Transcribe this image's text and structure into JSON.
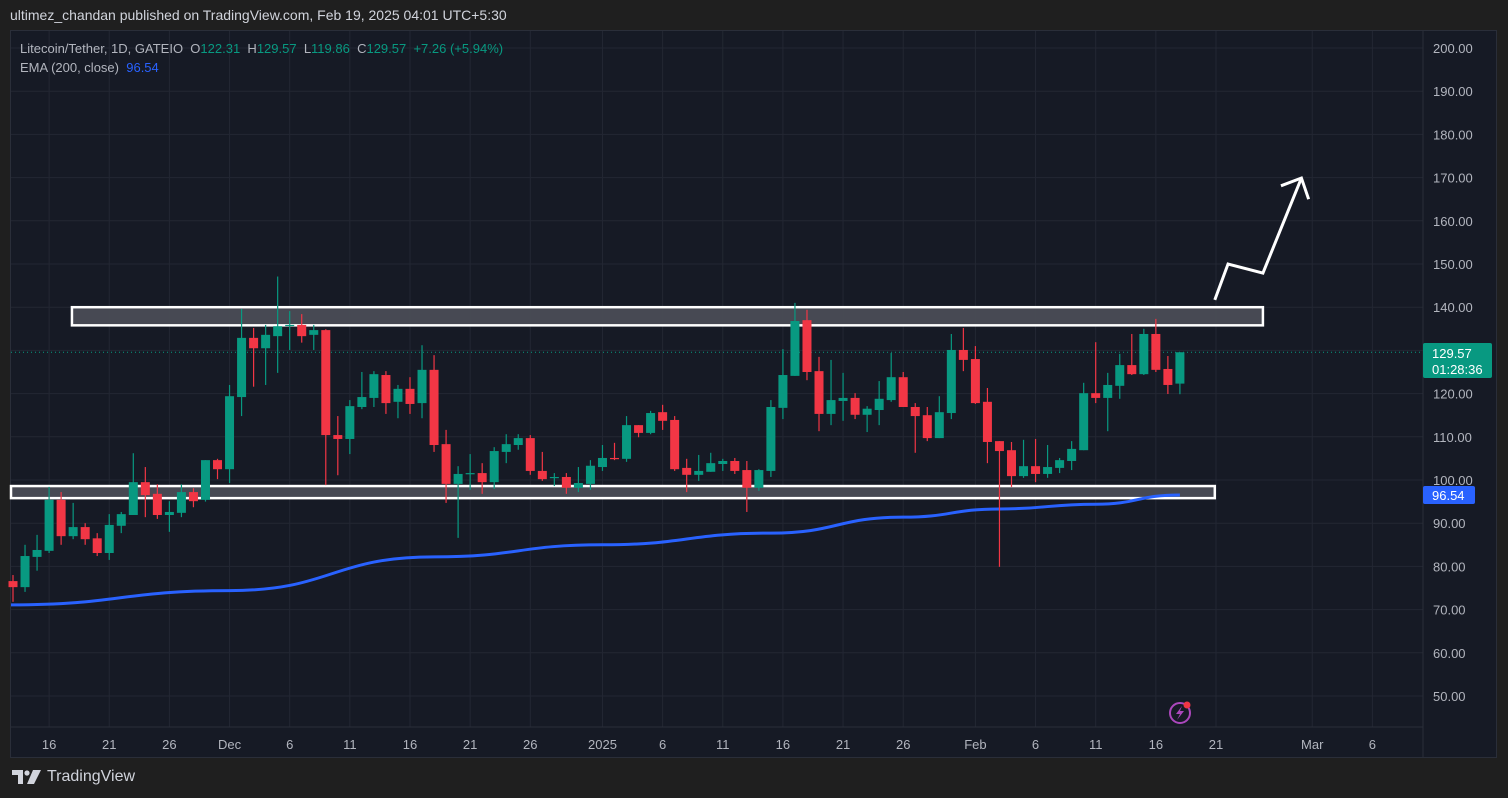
{
  "header": {
    "published": "ultimez_chandan published on TradingView.com, Feb 19, 2025 04:01 UTC+5:30"
  },
  "legend": {
    "symbol": "Litecoin/Tether, 1D, GATEIO",
    "o_label": "O",
    "o": "122.31",
    "h_label": "H",
    "h": "129.57",
    "l_label": "L",
    "l": "119.86",
    "c_label": "C",
    "c": "129.57",
    "change": "+7.26 (+5.94%)",
    "ema_label": "EMA (200, close)",
    "ema_value": "96.54"
  },
  "price_tag": {
    "price": "129.57",
    "countdown": "01:28:36"
  },
  "ema_tag": {
    "value": "96.54"
  },
  "footer": {
    "brand": "TradingView"
  },
  "colors": {
    "up": "#089981",
    "down": "#f23645",
    "ema": "#2962ff",
    "zone_fill": "#4a4c55",
    "zone_border": "#ffffff"
  },
  "chart_data": {
    "type": "candlestick",
    "title": "Litecoin/Tether, 1D, GATEIO",
    "ylim": [
      45,
      205
    ],
    "y_ticks": [
      "200.00",
      "190.00",
      "180.00",
      "170.00",
      "160.00",
      "150.00",
      "140.00",
      "130.00",
      "120.00",
      "110.00",
      "100.00",
      "90.00",
      "80.00",
      "70.00",
      "60.00",
      "50.00"
    ],
    "y_tick_values": [
      200,
      190,
      180,
      170,
      160,
      150,
      140,
      130,
      120,
      110,
      100,
      90,
      80,
      70,
      60,
      50
    ],
    "x_ticks": [
      {
        "label": "16",
        "day": 3
      },
      {
        "label": "21",
        "day": 8
      },
      {
        "label": "26",
        "day": 13
      },
      {
        "label": "Dec",
        "day": 18
      },
      {
        "label": "6",
        "day": 23
      },
      {
        "label": "11",
        "day": 28
      },
      {
        "label": "16",
        "day": 33
      },
      {
        "label": "21",
        "day": 38
      },
      {
        "label": "26",
        "day": 43
      },
      {
        "label": "2025",
        "day": 49
      },
      {
        "label": "6",
        "day": 54
      },
      {
        "label": "11",
        "day": 59
      },
      {
        "label": "16",
        "day": 64
      },
      {
        "label": "21",
        "day": 69
      },
      {
        "label": "26",
        "day": 74
      },
      {
        "label": "Feb",
        "day": 80
      },
      {
        "label": "6",
        "day": 85
      },
      {
        "label": "11",
        "day": 90
      },
      {
        "label": "16",
        "day": 95
      },
      {
        "label": "21",
        "day": 100
      },
      {
        "label": "Mar",
        "day": 108
      },
      {
        "label": "6",
        "day": 113
      }
    ],
    "ohlc": [
      [
        76.6,
        78.0,
        71.8,
        75.2
      ],
      [
        75.2,
        85.0,
        74.1,
        82.4
      ],
      [
        82.2,
        87.3,
        79.0,
        83.8
      ],
      [
        83.6,
        98.4,
        83.1,
        95.4
      ],
      [
        95.4,
        97.2,
        85.0,
        87.0
      ],
      [
        87.0,
        94.7,
        86.3,
        89.1
      ],
      [
        89.1,
        90.0,
        85.0,
        86.3
      ],
      [
        86.5,
        87.7,
        82.4,
        83.1
      ],
      [
        83.1,
        92.1,
        81.5,
        89.6
      ],
      [
        89.4,
        92.6,
        87.7,
        92.1
      ],
      [
        91.9,
        106.2,
        91.9,
        99.5
      ],
      [
        99.5,
        103.0,
        91.4,
        96.5
      ],
      [
        96.8,
        99.0,
        91.0,
        91.9
      ],
      [
        91.9,
        95.1,
        88.0,
        92.6
      ],
      [
        92.4,
        99.0,
        91.4,
        97.2
      ],
      [
        97.2,
        98.1,
        93.7,
        95.1
      ],
      [
        95.4,
        104.6,
        95.0,
        104.6
      ],
      [
        104.6,
        104.9,
        100.2,
        102.5
      ],
      [
        102.5,
        122.0,
        99.3,
        119.4
      ],
      [
        119.2,
        139.6,
        114.8,
        132.9
      ],
      [
        132.9,
        135.2,
        121.6,
        130.5
      ],
      [
        130.5,
        135.9,
        122.0,
        133.6
      ],
      [
        133.3,
        147.1,
        124.8,
        135.6
      ],
      [
        135.7,
        139.1,
        130.1,
        135.9
      ],
      [
        135.9,
        138.4,
        131.8,
        133.3
      ],
      [
        133.6,
        135.9,
        130.1,
        134.7
      ],
      [
        134.7,
        134.9,
        98.8,
        110.4
      ],
      [
        110.4,
        114.8,
        101.1,
        109.5
      ],
      [
        109.5,
        118.5,
        106.0,
        117.1
      ],
      [
        116.9,
        125.0,
        116.4,
        119.2
      ],
      [
        119.0,
        125.2,
        116.9,
        124.5
      ],
      [
        124.3,
        125.2,
        115.3,
        117.8
      ],
      [
        118.1,
        122.0,
        114.3,
        121.1
      ],
      [
        121.1,
        123.8,
        115.3,
        117.6
      ],
      [
        117.8,
        131.2,
        114.3,
        125.5
      ],
      [
        125.5,
        128.9,
        106.5,
        108.1
      ],
      [
        108.3,
        111.6,
        94.7,
        99.1
      ],
      [
        99.1,
        103.2,
        86.6,
        101.4
      ],
      [
        101.4,
        106.0,
        97.7,
        101.6
      ],
      [
        101.6,
        103.9,
        96.8,
        99.5
      ],
      [
        99.5,
        107.6,
        97.9,
        106.7
      ],
      [
        106.5,
        110.6,
        103.9,
        108.3
      ],
      [
        108.1,
        110.6,
        107.0,
        109.7
      ],
      [
        109.7,
        110.4,
        101.2,
        102.1
      ],
      [
        102.1,
        106.5,
        99.8,
        100.2
      ],
      [
        100.5,
        101.6,
        98.6,
        100.7
      ],
      [
        100.7,
        101.6,
        96.8,
        98.2
      ],
      [
        98.2,
        103.0,
        97.2,
        99.3
      ],
      [
        99.1,
        104.6,
        97.7,
        103.3
      ],
      [
        103.0,
        108.1,
        102.1,
        105.1
      ],
      [
        105.1,
        108.6,
        104.6,
        104.9
      ],
      [
        104.9,
        114.8,
        104.2,
        112.7
      ],
      [
        112.7,
        112.7,
        109.9,
        110.9
      ],
      [
        110.9,
        116.0,
        110.6,
        115.5
      ],
      [
        115.7,
        117.4,
        111.6,
        113.7
      ],
      [
        113.9,
        114.8,
        102.1,
        102.5
      ],
      [
        102.8,
        104.9,
        97.2,
        101.2
      ],
      [
        101.2,
        105.8,
        99.8,
        102.1
      ],
      [
        101.9,
        106.3,
        101.9,
        103.9
      ],
      [
        103.7,
        104.9,
        102.1,
        104.4
      ],
      [
        104.4,
        105.1,
        101.4,
        102.1
      ],
      [
        102.3,
        104.4,
        92.6,
        98.2
      ],
      [
        98.2,
        102.5,
        97.5,
        102.3
      ],
      [
        102.1,
        118.5,
        100.7,
        116.9
      ],
      [
        116.7,
        130.3,
        114.1,
        124.3
      ],
      [
        124.1,
        141.0,
        124.1,
        136.8
      ],
      [
        137.0,
        139.4,
        123.1,
        125.0
      ],
      [
        125.2,
        128.5,
        111.3,
        115.3
      ],
      [
        115.3,
        127.8,
        112.7,
        118.5
      ],
      [
        118.3,
        124.8,
        113.7,
        119.0
      ],
      [
        119.0,
        120.1,
        114.1,
        115.1
      ],
      [
        115.1,
        117.1,
        111.1,
        116.5
      ],
      [
        116.2,
        122.9,
        112.7,
        118.8
      ],
      [
        118.5,
        129.4,
        118.1,
        123.8
      ],
      [
        123.8,
        125.0,
        116.9,
        116.9
      ],
      [
        116.9,
        117.8,
        106.3,
        114.8
      ],
      [
        115.0,
        116.9,
        109.0,
        109.7
      ],
      [
        109.7,
        119.4,
        109.7,
        115.7
      ],
      [
        115.5,
        133.8,
        114.1,
        130.1
      ],
      [
        130.1,
        135.2,
        125.2,
        127.8
      ],
      [
        128.0,
        131.0,
        117.6,
        117.8
      ],
      [
        118.1,
        121.3,
        103.9,
        108.8
      ],
      [
        109.0,
        109.0,
        79.9,
        106.7
      ],
      [
        106.9,
        108.8,
        98.4,
        100.9
      ],
      [
        100.9,
        109.3,
        100.5,
        103.2
      ],
      [
        103.2,
        109.5,
        99.5,
        101.4
      ],
      [
        101.4,
        108.1,
        100.5,
        103.0
      ],
      [
        102.8,
        105.1,
        101.6,
        104.6
      ],
      [
        104.4,
        109.0,
        102.3,
        107.2
      ],
      [
        106.9,
        122.5,
        106.9,
        120.1
      ],
      [
        120.1,
        131.9,
        117.8,
        119.0
      ],
      [
        119.0,
        124.8,
        111.3,
        122.0
      ],
      [
        121.8,
        129.2,
        118.8,
        126.6
      ],
      [
        126.6,
        133.8,
        124.3,
        124.5
      ],
      [
        124.5,
        135.0,
        124.3,
        133.8
      ],
      [
        133.8,
        137.3,
        125.0,
        125.5
      ],
      [
        125.7,
        128.7,
        119.9,
        122.0
      ],
      [
        122.31,
        129.57,
        119.86,
        129.57
      ]
    ],
    "ema200": [
      [
        -0.3,
        71.1
      ],
      [
        18,
        74.4
      ],
      [
        35,
        82.2
      ],
      [
        49,
        85.0
      ],
      [
        63,
        87.7
      ],
      [
        74,
        91.4
      ],
      [
        82,
        93.3
      ],
      [
        90,
        94.4
      ],
      [
        97,
        96.54
      ]
    ],
    "last_price": 129.57,
    "annotations": {
      "resistance_zone": {
        "from_day": 4.9,
        "to_day": 103.9,
        "low": 135.8,
        "high": 140.0
      },
      "support_zone": {
        "from_day": -0.3,
        "to_day": 99.9,
        "low": 95.8,
        "high": 98.6
      },
      "projection_arrow": [
        [
          99.9,
          141.7
        ],
        [
          101.0,
          150.0
        ],
        [
          103.9,
          147.9
        ],
        [
          107.1,
          169.9
        ]
      ],
      "arrow_head": [
        [
          105.4,
          168.1
        ],
        [
          107.7,
          165.0
        ]
      ]
    }
  }
}
